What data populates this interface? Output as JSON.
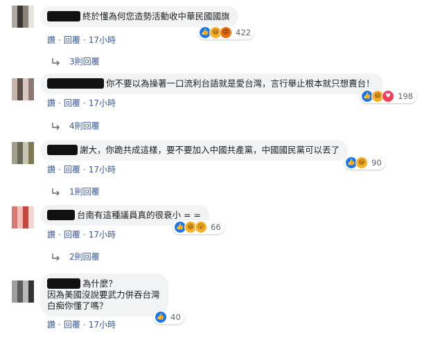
{
  "comments": [
    {
      "text": "終於懂為何您造勢活動收中華民國國旗",
      "reaction_icons": [
        "like-icon",
        "haha-icon",
        "angry-icon"
      ],
      "reaction_count": "422",
      "actions": {
        "like": "讚",
        "reply": "回覆",
        "time": "17小時"
      },
      "replies_label": "3則回覆"
    },
    {
      "text": "你不要以為操著一口流利台語就是愛台灣，言行舉止根本就只想賣台！",
      "reaction_icons": [
        "like-icon",
        "haha-icon",
        "love-icon"
      ],
      "reaction_count": "198",
      "actions": {
        "like": "讚",
        "reply": "回覆",
        "time": "17小時"
      },
      "replies_label": "4則回覆"
    },
    {
      "text": "謝大，你跪共成這樣，要不要加入中國共產黨，中國國民黨可以丟了",
      "reaction_icons": [
        "like-icon",
        "haha-icon"
      ],
      "reaction_count": "90",
      "actions": {
        "like": "讚",
        "reply": "回覆",
        "time": "17小時"
      },
      "replies_label": "1則回覆"
    },
    {
      "text": "台南有這種議員真的很衰小 = =",
      "reaction_icons": [
        "like-icon",
        "haha-icon",
        "wow-icon"
      ],
      "reaction_count": "66",
      "actions": {
        "like": "讚",
        "reply": "回覆",
        "time": "17小時"
      },
      "replies_label": "2則回覆"
    },
    {
      "text_lines": [
        "為什麼？",
        "因為美國沒說要武力併吞台灣",
        "白痴你懂了嗎？"
      ],
      "reaction_icons": [
        "like-icon"
      ],
      "reaction_count": "40",
      "actions": {
        "like": "讚",
        "reply": "回覆",
        "time": "17小時"
      }
    }
  ],
  "colors": {
    "like": "#1877f2",
    "link": "#385898",
    "bubble": "#f2f3f5"
  }
}
